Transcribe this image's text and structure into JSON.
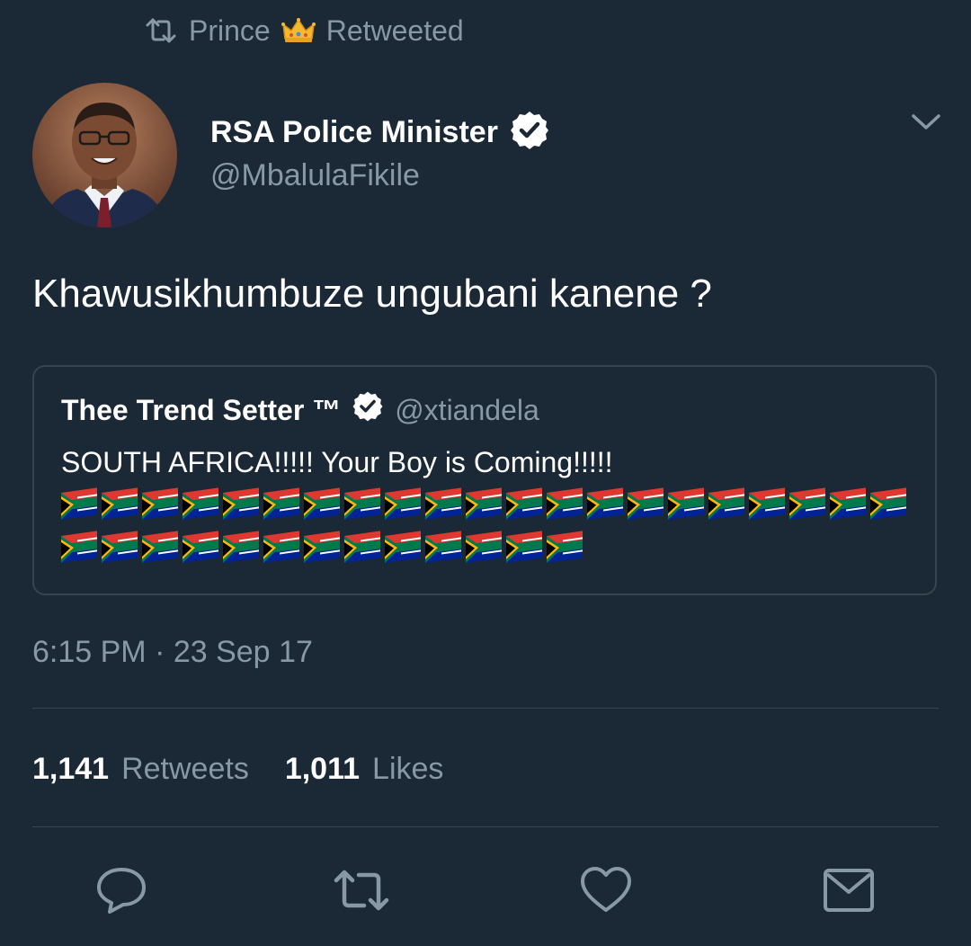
{
  "retweet_context": {
    "user": "Prince",
    "label": "Retweeted"
  },
  "tweet": {
    "display_name": "RSA Police Minister",
    "handle": "@MbalulaFikile",
    "text": "Khawusikhumbuze ungubani kanene ?",
    "timestamp": "6:15 PM · 23 Sep 17"
  },
  "quote": {
    "display_name": "Thee Trend Setter ™",
    "handle": "@xtiandela",
    "text": "SOUTH AFRICA!!!!! Your Boy is Coming!!!!!",
    "flag_count": 34
  },
  "stats": {
    "retweets_count": "1,141",
    "retweets_label": "Retweets",
    "likes_count": "1,011",
    "likes_label": "Likes"
  },
  "actions": {
    "icons": [
      "reply-icon",
      "retweet-icon",
      "like-icon",
      "message-icon"
    ]
  },
  "colors": {
    "background": "#1b2836",
    "muted": "#8899a6",
    "border": "#38444d"
  }
}
